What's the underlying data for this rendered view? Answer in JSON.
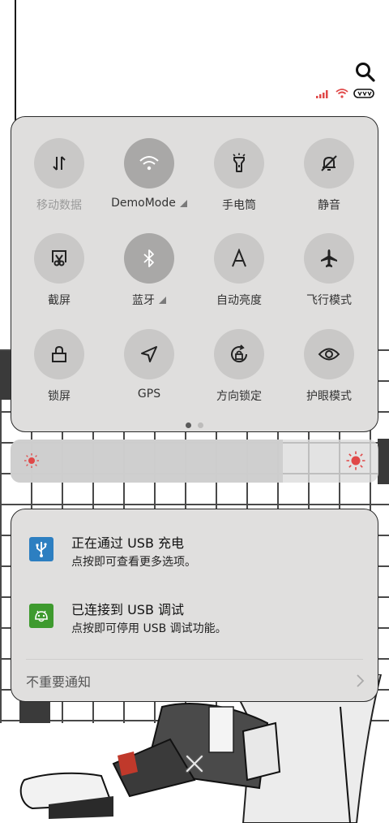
{
  "status_bar": {
    "search_icon": "search-icon",
    "signal_icon": "signal-bars-icon",
    "wifi_icon": "wifi-icon",
    "battery_icon": "battery-icon",
    "accent_color": "#e04848"
  },
  "quick_settings": {
    "tiles": [
      {
        "label": "移动数据",
        "icon": "mobile-data-icon",
        "active": false,
        "dim": true
      },
      {
        "label": "DemoMode",
        "icon": "wifi-icon",
        "active": true,
        "expand": true
      },
      {
        "label": "手电筒",
        "icon": "flashlight-icon",
        "active": false
      },
      {
        "label": "静音",
        "icon": "bell-off-icon",
        "active": false
      },
      {
        "label": "截屏",
        "icon": "screenshot-icon",
        "active": false
      },
      {
        "label": "蓝牙",
        "icon": "bluetooth-icon",
        "active": true,
        "expand": true
      },
      {
        "label": "自动亮度",
        "icon": "auto-brightness-icon",
        "active": false
      },
      {
        "label": "飞行模式",
        "icon": "airplane-icon",
        "active": false
      },
      {
        "label": "锁屏",
        "icon": "lock-icon",
        "active": false
      },
      {
        "label": "GPS",
        "icon": "location-arrow-icon",
        "active": false
      },
      {
        "label": "方向锁定",
        "icon": "rotation-lock-icon",
        "active": false
      },
      {
        "label": "护眼模式",
        "icon": "eye-icon",
        "active": false
      }
    ],
    "page_count": 2,
    "current_page": 1
  },
  "brightness": {
    "level": 0.74,
    "min_icon": "brightness-low-icon",
    "max_icon": "brightness-high-icon"
  },
  "notifications": {
    "items": [
      {
        "title": "正在通过 USB 充电",
        "subtitle": "点按即可查看更多选项。",
        "icon": "usb-icon",
        "icon_color": "#2d7fc1"
      },
      {
        "title": "已连接到 USB 调试",
        "subtitle": "点按即可停用 USB 调试功能。",
        "icon": "android-debug-icon",
        "icon_color": "#3e9a2e"
      }
    ],
    "unimportant_label": "不重要通知",
    "chevron_icon": "chevron-right-icon"
  },
  "dismiss_icon": "close-icon"
}
